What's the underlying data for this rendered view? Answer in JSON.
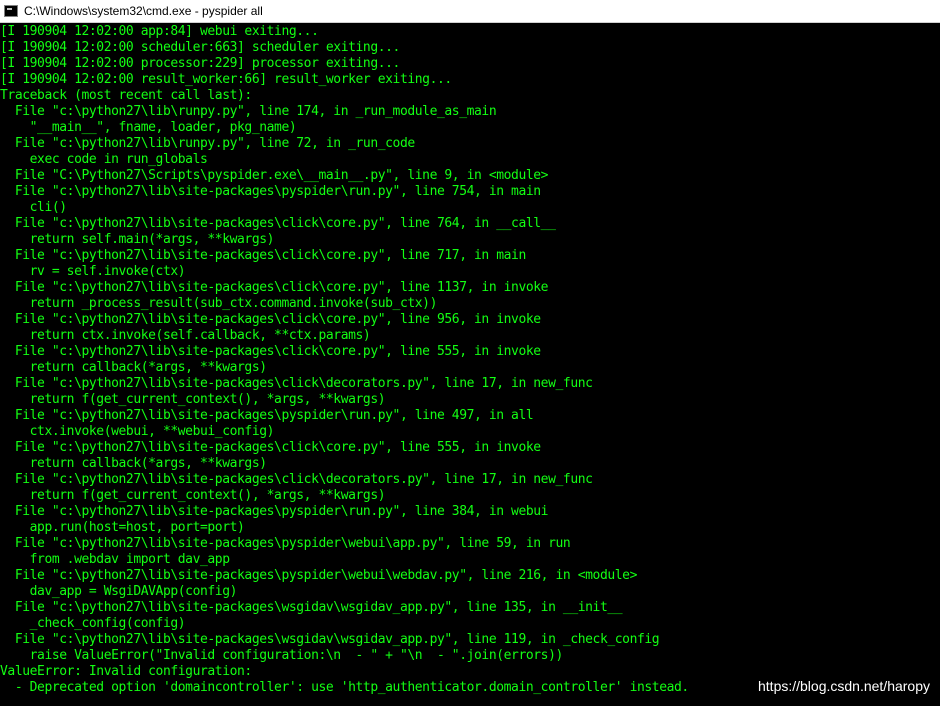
{
  "window": {
    "title": "C:\\Windows\\system32\\cmd.exe - pyspider  all",
    "icon": "cmd-icon"
  },
  "console": {
    "text_color": "#13ff13",
    "background": "#000000",
    "lines": [
      "[I 190904 12:02:00 app:84] webui exiting...",
      "[I 190904 12:02:00 scheduler:663] scheduler exiting...",
      "[I 190904 12:02:00 processor:229] processor exiting...",
      "[I 190904 12:02:00 result_worker:66] result_worker exiting...",
      "Traceback (most recent call last):",
      "  File \"c:\\python27\\lib\\runpy.py\", line 174, in _run_module_as_main",
      "    \"__main__\", fname, loader, pkg_name)",
      "  File \"c:\\python27\\lib\\runpy.py\", line 72, in _run_code",
      "    exec code in run_globals",
      "  File \"C:\\Python27\\Scripts\\pyspider.exe\\__main__.py\", line 9, in <module>",
      "  File \"c:\\python27\\lib\\site-packages\\pyspider\\run.py\", line 754, in main",
      "    cli()",
      "  File \"c:\\python27\\lib\\site-packages\\click\\core.py\", line 764, in __call__",
      "    return self.main(*args, **kwargs)",
      "  File \"c:\\python27\\lib\\site-packages\\click\\core.py\", line 717, in main",
      "    rv = self.invoke(ctx)",
      "  File \"c:\\python27\\lib\\site-packages\\click\\core.py\", line 1137, in invoke",
      "    return _process_result(sub_ctx.command.invoke(sub_ctx))",
      "  File \"c:\\python27\\lib\\site-packages\\click\\core.py\", line 956, in invoke",
      "    return ctx.invoke(self.callback, **ctx.params)",
      "  File \"c:\\python27\\lib\\site-packages\\click\\core.py\", line 555, in invoke",
      "    return callback(*args, **kwargs)",
      "  File \"c:\\python27\\lib\\site-packages\\click\\decorators.py\", line 17, in new_func",
      "    return f(get_current_context(), *args, **kwargs)",
      "  File \"c:\\python27\\lib\\site-packages\\pyspider\\run.py\", line 497, in all",
      "    ctx.invoke(webui, **webui_config)",
      "  File \"c:\\python27\\lib\\site-packages\\click\\core.py\", line 555, in invoke",
      "    return callback(*args, **kwargs)",
      "  File \"c:\\python27\\lib\\site-packages\\click\\decorators.py\", line 17, in new_func",
      "    return f(get_current_context(), *args, **kwargs)",
      "  File \"c:\\python27\\lib\\site-packages\\pyspider\\run.py\", line 384, in webui",
      "    app.run(host=host, port=port)",
      "  File \"c:\\python27\\lib\\site-packages\\pyspider\\webui\\app.py\", line 59, in run",
      "    from .webdav import dav_app",
      "  File \"c:\\python27\\lib\\site-packages\\pyspider\\webui\\webdav.py\", line 216, in <module>",
      "    dav_app = WsgiDAVApp(config)",
      "  File \"c:\\python27\\lib\\site-packages\\wsgidav\\wsgidav_app.py\", line 135, in __init__",
      "    _check_config(config)",
      "  File \"c:\\python27\\lib\\site-packages\\wsgidav\\wsgidav_app.py\", line 119, in _check_config",
      "    raise ValueError(\"Invalid configuration:\\n  - \" + \"\\n  - \".join(errors))",
      "ValueError: Invalid configuration:",
      "  - Deprecated option 'domaincontroller': use 'http_authenticator.domain_controller' instead."
    ]
  },
  "watermark": "https://blog.csdn.net/haropy"
}
